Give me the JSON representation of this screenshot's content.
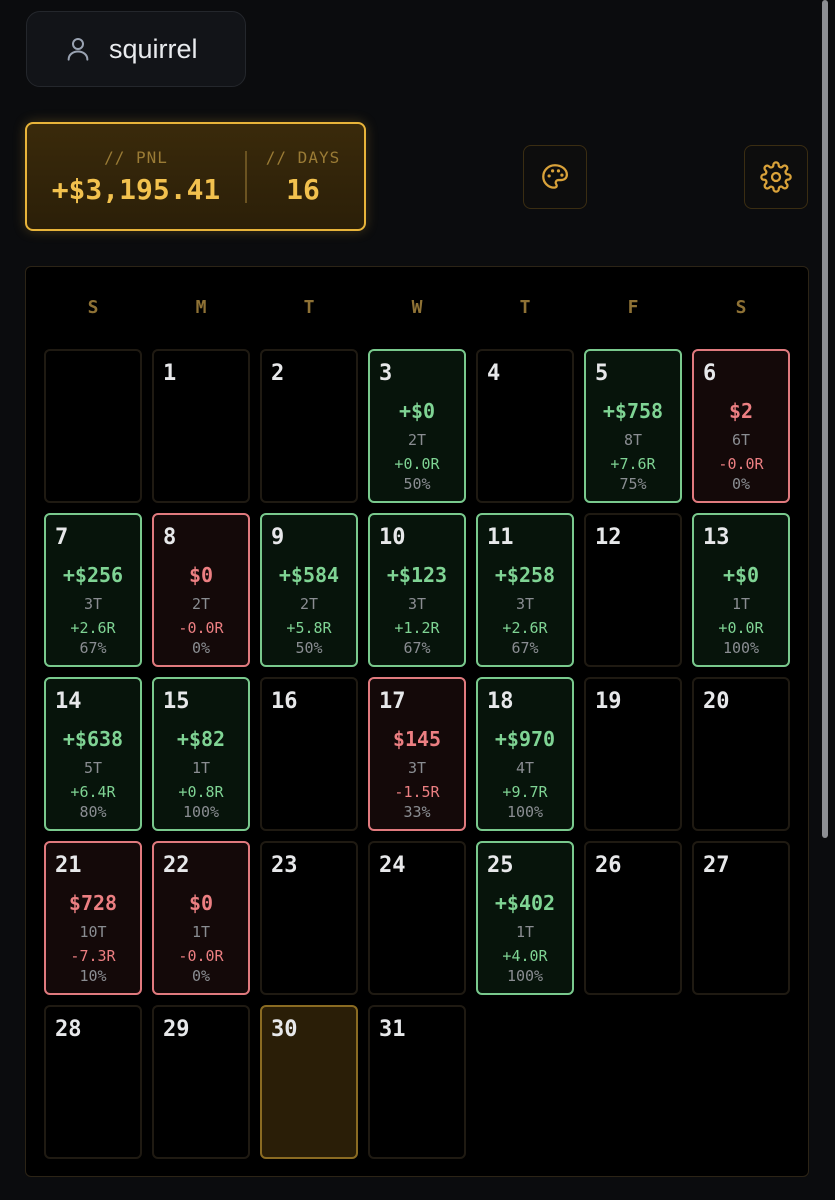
{
  "user": {
    "name": "squirrel",
    "icon": "user-icon"
  },
  "stats": {
    "pnl_label": "// PNL",
    "pnl_value": "+$3,195.41",
    "days_label": "// DAYS",
    "days_value": "16"
  },
  "toolbar": {
    "palette_icon": "palette-icon",
    "settings_icon": "gear-icon"
  },
  "colors": {
    "accent": "#f2c14e",
    "gain": "#7fd494",
    "loss": "#ec7f82",
    "today": "#8a6b22"
  },
  "calendar": {
    "weekdays": [
      "S",
      "M",
      "T",
      "W",
      "T",
      "F",
      "S"
    ],
    "days": [
      {
        "day": "",
        "status": "empty"
      },
      {
        "day": "1",
        "status": "none"
      },
      {
        "day": "2",
        "status": "none"
      },
      {
        "day": "3",
        "status": "gain",
        "pnl": "+$0",
        "trades": "2T",
        "r": "+0.0R",
        "winrate": "50%"
      },
      {
        "day": "4",
        "status": "none"
      },
      {
        "day": "5",
        "status": "gain",
        "pnl": "+$758",
        "trades": "8T",
        "r": "+7.6R",
        "winrate": "75%"
      },
      {
        "day": "6",
        "status": "loss",
        "pnl": "$2",
        "trades": "6T",
        "r": "-0.0R",
        "winrate": "0%"
      },
      {
        "day": "7",
        "status": "gain",
        "pnl": "+$256",
        "trades": "3T",
        "r": "+2.6R",
        "winrate": "67%"
      },
      {
        "day": "8",
        "status": "loss",
        "pnl": "$0",
        "trades": "2T",
        "r": "-0.0R",
        "winrate": "0%"
      },
      {
        "day": "9",
        "status": "gain",
        "pnl": "+$584",
        "trades": "2T",
        "r": "+5.8R",
        "winrate": "50%"
      },
      {
        "day": "10",
        "status": "gain",
        "pnl": "+$123",
        "trades": "3T",
        "r": "+1.2R",
        "winrate": "67%"
      },
      {
        "day": "11",
        "status": "gain",
        "pnl": "+$258",
        "trades": "3T",
        "r": "+2.6R",
        "winrate": "67%"
      },
      {
        "day": "12",
        "status": "none"
      },
      {
        "day": "13",
        "status": "gain",
        "pnl": "+$0",
        "trades": "1T",
        "r": "+0.0R",
        "winrate": "100%"
      },
      {
        "day": "14",
        "status": "gain",
        "pnl": "+$638",
        "trades": "5T",
        "r": "+6.4R",
        "winrate": "80%"
      },
      {
        "day": "15",
        "status": "gain",
        "pnl": "+$82",
        "trades": "1T",
        "r": "+0.8R",
        "winrate": "100%"
      },
      {
        "day": "16",
        "status": "none"
      },
      {
        "day": "17",
        "status": "loss",
        "pnl": "$145",
        "trades": "3T",
        "r": "-1.5R",
        "winrate": "33%"
      },
      {
        "day": "18",
        "status": "gain",
        "pnl": "+$970",
        "trades": "4T",
        "r": "+9.7R",
        "winrate": "100%"
      },
      {
        "day": "19",
        "status": "none"
      },
      {
        "day": "20",
        "status": "none"
      },
      {
        "day": "21",
        "status": "loss",
        "pnl": "$728",
        "trades": "10T",
        "r": "-7.3R",
        "winrate": "10%"
      },
      {
        "day": "22",
        "status": "loss",
        "pnl": "$0",
        "trades": "1T",
        "r": "-0.0R",
        "winrate": "0%"
      },
      {
        "day": "23",
        "status": "none"
      },
      {
        "day": "24",
        "status": "none"
      },
      {
        "day": "25",
        "status": "gain",
        "pnl": "+$402",
        "trades": "1T",
        "r": "+4.0R",
        "winrate": "100%"
      },
      {
        "day": "26",
        "status": "none"
      },
      {
        "day": "27",
        "status": "none"
      },
      {
        "day": "28",
        "status": "none"
      },
      {
        "day": "29",
        "status": "none"
      },
      {
        "day": "30",
        "status": "today"
      },
      {
        "day": "31",
        "status": "none"
      }
    ]
  }
}
